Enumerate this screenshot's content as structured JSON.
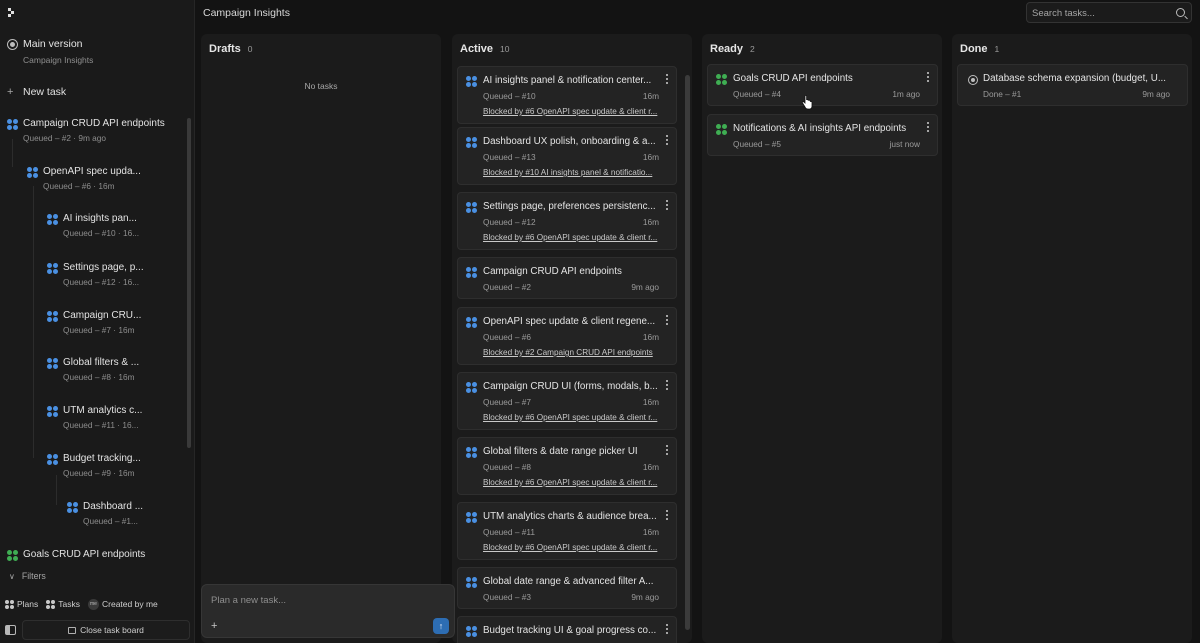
{
  "sidebar": {
    "main_version": {
      "title": "Main version",
      "subtitle": "Campaign Insights"
    },
    "new_task_label": "New task",
    "tree": [
      {
        "title": "Campaign CRUD API endpoints",
        "meta": "Queued – #2 · 9m ago",
        "icon": "status-grid-blue-icon"
      },
      {
        "title": "OpenAPI spec upda...",
        "meta": "Queued – #6 · 16m",
        "icon": "status-grid-blue-icon"
      },
      {
        "title": "AI insights pan...",
        "meta": "Queued – #10 · 16...",
        "icon": "status-grid-blue-icon"
      },
      {
        "title": "Settings page, p...",
        "meta": "Queued – #12 · 16...",
        "icon": "status-grid-blue-icon"
      },
      {
        "title": "Campaign CRU...",
        "meta": "Queued – #7 · 16m",
        "icon": "status-grid-blue-icon"
      },
      {
        "title": "Global filters & ...",
        "meta": "Queued – #8 · 16m",
        "icon": "status-grid-blue-icon"
      },
      {
        "title": "UTM analytics c...",
        "meta": "Queued – #11 · 16...",
        "icon": "status-grid-blue-icon"
      },
      {
        "title": "Budget tracking...",
        "meta": "Queued – #9 · 16m",
        "icon": "status-grid-blue-icon"
      },
      {
        "title": "Dashboard ...",
        "meta": "Queued – #1...",
        "icon": "status-grid-blue-icon"
      },
      {
        "title": "Goals CRUD API endpoints",
        "meta": "",
        "icon": "status-grid-green-icon"
      }
    ],
    "filters_label": "Filters",
    "bottom_tabs": {
      "plans": "Plans",
      "tasks": "Tasks",
      "me_avatar": "me",
      "created_by_me": "Created by me"
    },
    "close_board_label": "Close task board"
  },
  "header": {
    "title": "Campaign Insights",
    "search_placeholder": "Search tasks..."
  },
  "columns": {
    "drafts": {
      "name": "Drafts",
      "count": "0",
      "empty": "No tasks"
    },
    "active": {
      "name": "Active",
      "count": "10",
      "cards": [
        {
          "title": "AI insights panel & notification center...",
          "meta": "Queued – #10",
          "time": "16m",
          "blocked": "Blocked by #6 OpenAPI spec update & client r..."
        },
        {
          "title": "Dashboard UX polish, onboarding & a...",
          "meta": "Queued – #13",
          "time": "16m",
          "blocked": "Blocked by #10 AI insights panel & notificatio..."
        },
        {
          "title": "Settings page, preferences persistenc...",
          "meta": "Queued – #12",
          "time": "16m",
          "blocked": "Blocked by #6 OpenAPI spec update & client r..."
        },
        {
          "title": "Campaign CRUD API endpoints",
          "meta": "Queued – #2",
          "time": "9m ago",
          "blocked": ""
        },
        {
          "title": "OpenAPI spec update & client regene...",
          "meta": "Queued – #6",
          "time": "16m",
          "blocked": "Blocked by #2 Campaign CRUD API endpoints"
        },
        {
          "title": "Campaign CRUD UI (forms, modals, b...",
          "meta": "Queued – #7",
          "time": "16m",
          "blocked": "Blocked by #6 OpenAPI spec update & client r..."
        },
        {
          "title": "Global filters & date range picker UI",
          "meta": "Queued – #8",
          "time": "16m",
          "blocked": "Blocked by #6 OpenAPI spec update & client r..."
        },
        {
          "title": "UTM analytics charts & audience brea...",
          "meta": "Queued – #11",
          "time": "16m",
          "blocked": "Blocked by #6 OpenAPI spec update & client r..."
        },
        {
          "title": "Global date range & advanced filter A...",
          "meta": "Queued – #3",
          "time": "9m ago",
          "blocked": ""
        },
        {
          "title": "Budget tracking UI & goal progress co...",
          "meta": "",
          "time": "",
          "blocked": ""
        }
      ]
    },
    "ready": {
      "name": "Ready",
      "count": "2",
      "cards": [
        {
          "title": "Goals CRUD API endpoints",
          "meta": "Queued – #4",
          "time": "1m ago"
        },
        {
          "title": "Notifications & AI insights API endpoints",
          "meta": "Queued – #5",
          "time": "just now"
        }
      ]
    },
    "done": {
      "name": "Done",
      "count": "1",
      "cards": [
        {
          "title": "Database schema expansion (budget, U...",
          "meta": "Done – #1",
          "time": "9m ago"
        }
      ]
    }
  },
  "plan_box": {
    "placeholder": "Plan a new task...",
    "plus": "+",
    "send": "↑"
  },
  "colors": {
    "blue": "#4a90e2",
    "green": "#3fae53",
    "accent": "#2d6db3"
  }
}
